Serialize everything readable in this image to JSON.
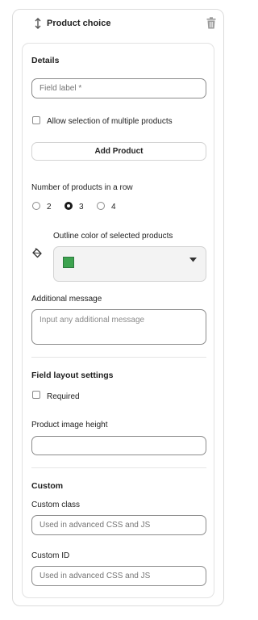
{
  "header": {
    "title": "Product choice"
  },
  "details": {
    "title": "Details",
    "field_label_placeholder": "Field label *",
    "allow_multiple_label": "Allow selection of multiple products",
    "add_product_label": "Add Product"
  },
  "row_count": {
    "label": "Number of products in a row",
    "options": [
      "2",
      "3",
      "4"
    ],
    "selected": "3"
  },
  "outline": {
    "label": "Outline color of selected products",
    "color": "#3da34f"
  },
  "message": {
    "label": "Additional message",
    "placeholder": "Input any additional message"
  },
  "layout": {
    "title": "Field layout settings",
    "required_label": "Required",
    "image_height_label": "Product image height"
  },
  "custom": {
    "title": "Custom",
    "class_label": "Custom class",
    "class_placeholder": "Used in advanced CSS and JS",
    "id_label": "Custom ID",
    "id_placeholder": "Used in advanced CSS and JS"
  }
}
